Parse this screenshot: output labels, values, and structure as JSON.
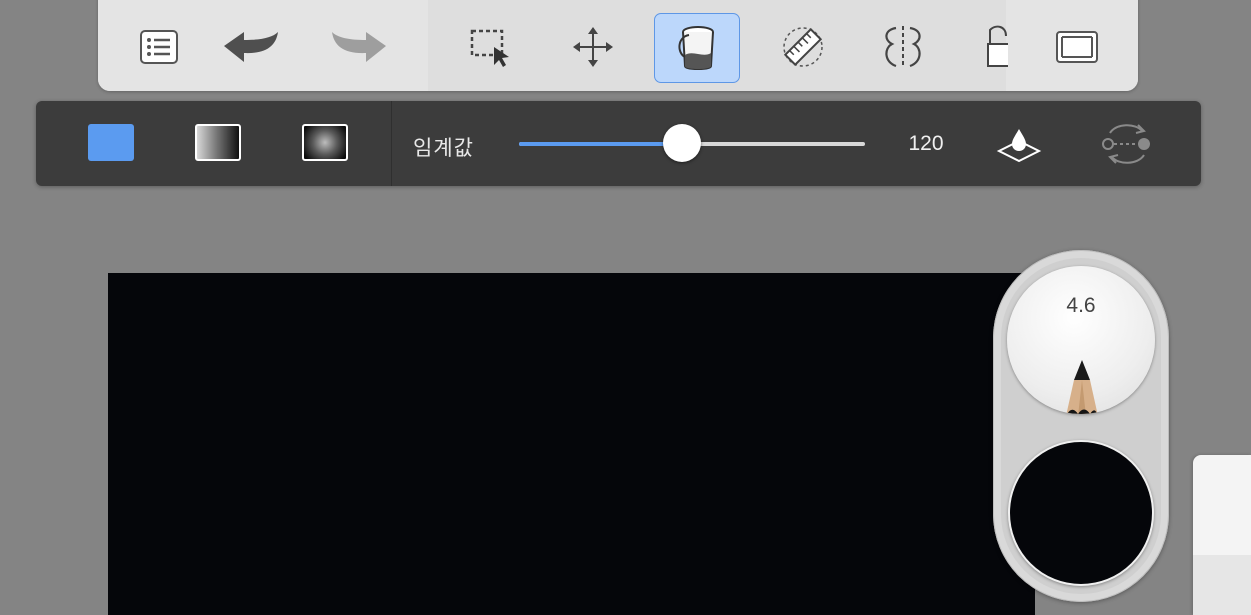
{
  "toolbar": {
    "tools": [
      {
        "name": "layers-list",
        "active": false
      },
      {
        "name": "undo",
        "active": false
      },
      {
        "name": "redo",
        "active": false,
        "disabled": true
      },
      {
        "name": "selection",
        "active": false
      },
      {
        "name": "transform-move",
        "active": false
      },
      {
        "name": "fill-bucket",
        "active": true
      },
      {
        "name": "ruler-guides",
        "active": false
      },
      {
        "name": "symmetry",
        "active": false
      },
      {
        "name": "perspective",
        "active": false
      },
      {
        "name": "fullscreen-toggle",
        "active": false
      }
    ]
  },
  "fill_options": {
    "modes": [
      "solid",
      "linear-gradient",
      "radial-gradient"
    ],
    "selected_mode": "solid",
    "threshold_label": "임계값",
    "threshold_value": "120",
    "threshold_fraction": 0.47
  },
  "brush_puck": {
    "size": "4.6",
    "brush_icon": "pencil-icon",
    "current_color": "#05060a"
  },
  "colors": {
    "accent": "#5b9bf0",
    "canvas": "#05060a"
  }
}
